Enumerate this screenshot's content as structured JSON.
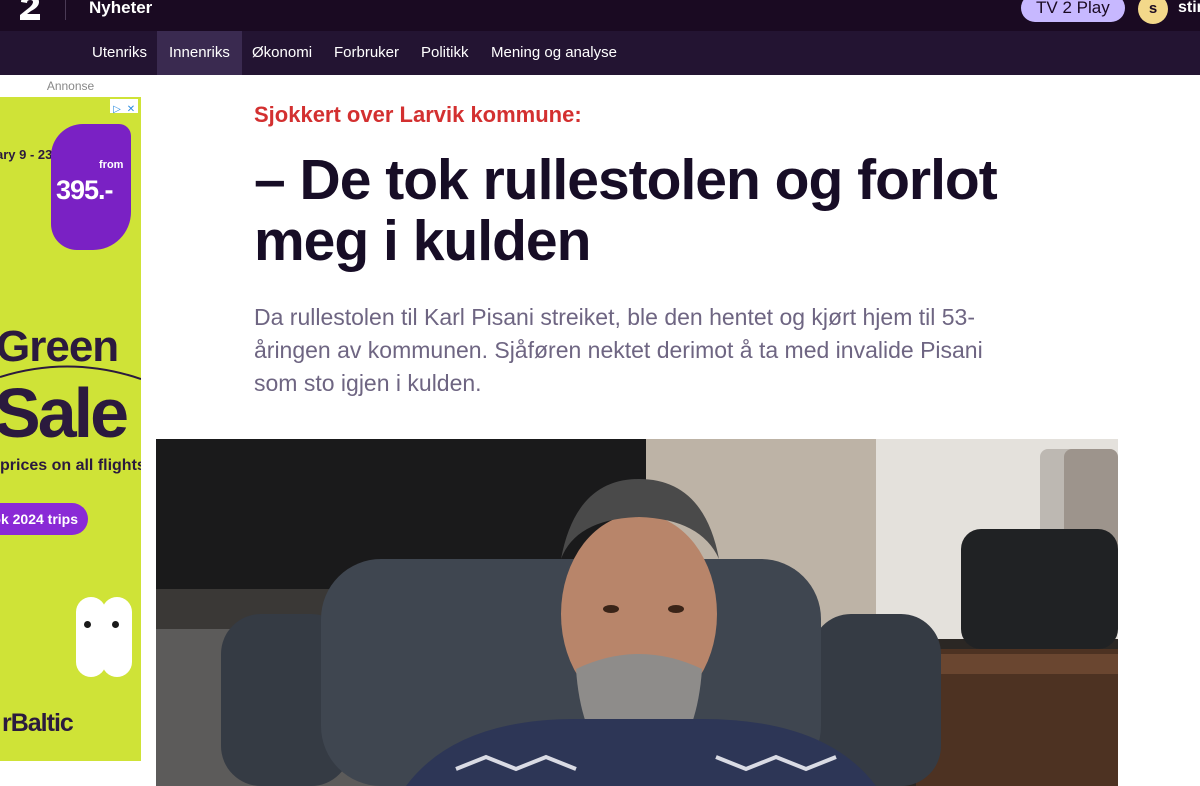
{
  "header": {
    "brand": "Nyheter",
    "play_button": "TV 2 Play",
    "avatar_initial": "s",
    "username": "stin"
  },
  "nav": {
    "items": [
      {
        "label": "Utenriks",
        "active": false
      },
      {
        "label": "Innenriks",
        "active": true
      },
      {
        "label": "Økonomi",
        "active": false
      },
      {
        "label": "Forbruker",
        "active": false
      },
      {
        "label": "Politikk",
        "active": false
      },
      {
        "label": "Mening og analyse",
        "active": false
      }
    ]
  },
  "ad": {
    "label": "Annonse",
    "dates": "ary 9 - 23",
    "price_from": "from",
    "price": "395.-",
    "headline_top": "Green",
    "headline_bottom": "Sale",
    "subline": "prices on all flights",
    "cta": "ok 2024 trips",
    "brand": "rBaltic"
  },
  "article": {
    "kicker": "Sjokkert over Larvik kommune:",
    "headline": "– De tok rullestolen og forlot meg i kulden",
    "lede": "Da rullestolen til Karl Pisani streiket, ble den hentet og kjørt hjem til 53-åringen av kommunen. Sjåføren nektet derimot å ta med invalide Pisani som sto igjen i kulden."
  },
  "colors": {
    "topbar": "#1a0a22",
    "navbar": "#231432",
    "nav_active": "#3a2a50",
    "kicker": "#d33030",
    "headline": "#170d26",
    "lede": "#6e6582",
    "play_button": "#c7b8ff",
    "ad_background": "#cfe337",
    "ad_accent": "#7a21c4"
  }
}
